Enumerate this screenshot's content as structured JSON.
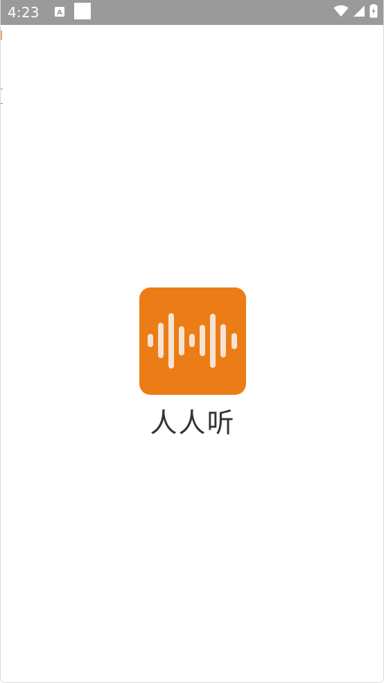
{
  "status_bar": {
    "time": "4:23",
    "left_icons": [
      "font-a-icon",
      "blank-square-icon"
    ],
    "right_icons": [
      "wifi-icon",
      "cell-signal-icon",
      "battery-charging-icon"
    ]
  },
  "splash": {
    "app_name": "人人听",
    "icon": "audio-waveform-icon",
    "icon_color": "#EC7D16",
    "wave_color": "#F6E3D3"
  },
  "colors": {
    "status_bar_bg": "#9A9A9A",
    "background": "#FFFFFF",
    "text": "#333333"
  }
}
